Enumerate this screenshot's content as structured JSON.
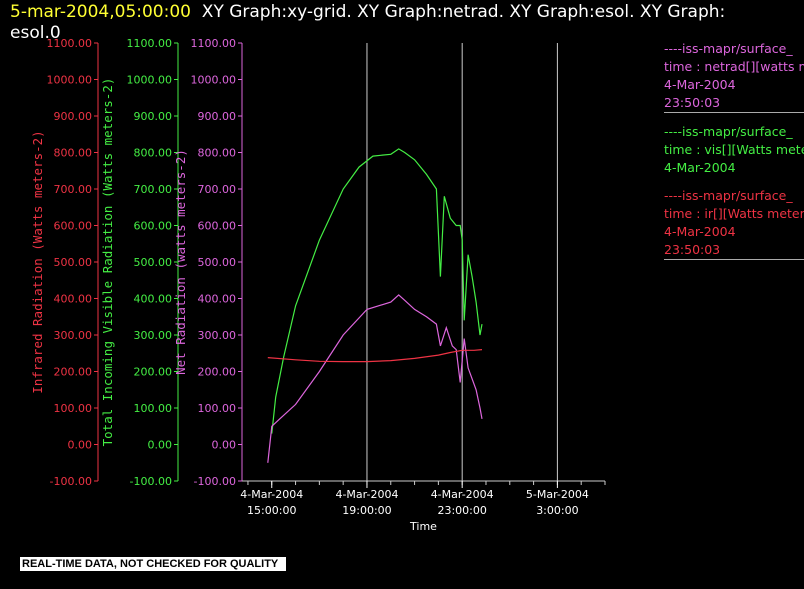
{
  "header": {
    "timestamp": "5-mar-2004,05:00:00",
    "title_rest": "XY Graph:xy-grid.  XY Graph:netrad.  XY Graph:esol.  XY Graph:",
    "title_line2": "esol.0"
  },
  "legend": [
    {
      "line1": "----iss-mapr/surface_",
      "line2": "time : netrad[][watts me",
      "line3": "4-Mar-2004",
      "line4": "23:50:03",
      "color": "#dd66dd"
    },
    {
      "line1": "----iss-mapr/surface_",
      "line2": "time : vis[][Watts mete",
      "line3": "4-Mar-2004",
      "line4": "",
      "color": "#44ee44"
    },
    {
      "line1": "----iss-mapr/surface_",
      "line2": "time : ir[][Watts meters",
      "line3": "4-Mar-2004",
      "line4": "23:50:03",
      "color": "#ee3344"
    }
  ],
  "footer": "REAL-TIME DATA, NOT CHECKED FOR QUALITY",
  "chart_data": {
    "type": "line",
    "xlabel": "Time",
    "x_ticks": [
      {
        "x": "2004-03-04T15:00",
        "line1": "4-Mar-2004",
        "line2": "15:00:00"
      },
      {
        "x": "2004-03-04T19:00",
        "line1": "4-Mar-2004",
        "line2": "19:00:00"
      },
      {
        "x": "2004-03-04T23:00",
        "line1": "4-Mar-2004",
        "line2": "23:00:00"
      },
      {
        "x": "2004-03-05T03:00",
        "line1": "5-Mar-2004",
        "line2": "3:00:00"
      }
    ],
    "xlim": [
      "2004-03-04T13:45",
      "2004-03-05T05:00"
    ],
    "vertical_grid": [
      "2004-03-04T19:00",
      "2004-03-04T23:00",
      "2004-03-05T03:00"
    ],
    "y_axes": [
      {
        "label": "Infrared Radiation (Watts meters-2)",
        "color": "#ee3344",
        "ticks": [
          "1100.00",
          "1000.00",
          "900.00",
          "800.00",
          "700.00",
          "600.00",
          "500.00",
          "400.00",
          "300.00",
          "200.00",
          "100.00",
          "0.00",
          "-100.00"
        ],
        "ylim": [
          -100,
          1100
        ]
      },
      {
        "label": "Total Incoming Visible Radiation (Watts meters-2)",
        "color": "#44ee44",
        "ticks": [
          "1100.00",
          "1000.00",
          "900.00",
          "800.00",
          "700.00",
          "600.00",
          "500.00",
          "400.00",
          "300.00",
          "200.00",
          "100.00",
          "0.00",
          "-100.00"
        ],
        "ylim": [
          -100,
          1100
        ]
      },
      {
        "label": "Net Radiation (watts meters-2)",
        "color": "#dd66dd",
        "ticks": [
          "1100.00",
          "1000.00",
          "900.00",
          "800.00",
          "700.00",
          "600.00",
          "500.00",
          "400.00",
          "300.00",
          "200.00",
          "100.00",
          "0.00",
          "-100.00"
        ],
        "ylim": [
          -100,
          1100
        ]
      }
    ],
    "series": [
      {
        "color": "#44ee44",
        "x": [
          "2004-03-04T15:00",
          "2004-03-04T15:10",
          "2004-03-04T15:30",
          "2004-03-04T16:00",
          "2004-03-04T17:00",
          "2004-03-04T18:00",
          "2004-03-04T18:40",
          "2004-03-04T19:15",
          "2004-03-04T20:00",
          "2004-03-04T20:20",
          "2004-03-04T20:35",
          "2004-03-04T21:00",
          "2004-03-04T21:30",
          "2004-03-04T21:55",
          "2004-03-04T22:05",
          "2004-03-04T22:15",
          "2004-03-04T22:30",
          "2004-03-04T22:45",
          "2004-03-04T22:55",
          "2004-03-04T23:00",
          "2004-03-04T23:05",
          "2004-03-04T23:15",
          "2004-03-04T23:25",
          "2004-03-04T23:35",
          "2004-03-04T23:45",
          "2004-03-04T23:50"
        ],
        "y": [
          30,
          130,
          240,
          380,
          560,
          700,
          760,
          790,
          795,
          810,
          800,
          780,
          740,
          700,
          460,
          680,
          620,
          600,
          600,
          560,
          340,
          520,
          460,
          390,
          300,
          330
        ]
      },
      {
        "color": "#dd66dd",
        "x": [
          "2004-03-04T14:50",
          "2004-03-04T15:00",
          "2004-03-04T15:20",
          "2004-03-04T16:00",
          "2004-03-04T17:00",
          "2004-03-04T18:00",
          "2004-03-04T19:00",
          "2004-03-04T20:00",
          "2004-03-04T20:20",
          "2004-03-04T20:35",
          "2004-03-04T21:00",
          "2004-03-04T21:30",
          "2004-03-04T21:55",
          "2004-03-04T22:05",
          "2004-03-04T22:20",
          "2004-03-04T22:35",
          "2004-03-04T22:45",
          "2004-03-04T22:55",
          "2004-03-04T23:05",
          "2004-03-04T23:15",
          "2004-03-04T23:25",
          "2004-03-04T23:35",
          "2004-03-04T23:45",
          "2004-03-04T23:50"
        ],
        "y": [
          -50,
          50,
          70,
          110,
          200,
          300,
          370,
          390,
          410,
          395,
          370,
          350,
          330,
          270,
          320,
          270,
          260,
          170,
          290,
          210,
          180,
          150,
          100,
          70
        ]
      },
      {
        "color": "#ee3344",
        "x": [
          "2004-03-04T14:50",
          "2004-03-04T16:00",
          "2004-03-04T17:00",
          "2004-03-04T18:00",
          "2004-03-04T19:00",
          "2004-03-04T20:00",
          "2004-03-04T21:00",
          "2004-03-04T22:00",
          "2004-03-04T22:30",
          "2004-03-04T23:00",
          "2004-03-04T23:30",
          "2004-03-04T23:50"
        ],
        "y": [
          238,
          232,
          228,
          227,
          227,
          230,
          236,
          245,
          252,
          258,
          258,
          260
        ]
      }
    ]
  }
}
